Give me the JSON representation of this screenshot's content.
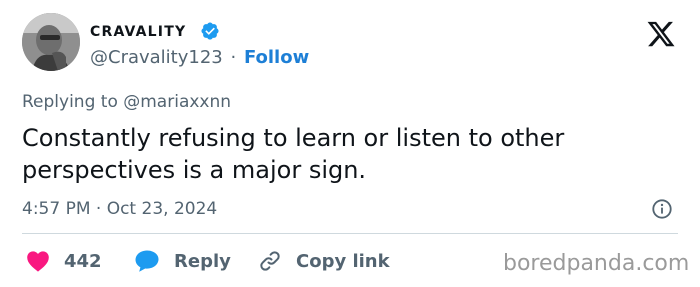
{
  "author": {
    "display_name": "CRAVALITY",
    "handle": "@Cravality123",
    "separator": "·",
    "follow_label": "Follow"
  },
  "reply_context": {
    "prefix": "Replying to",
    "mention": "@mariaxxnn"
  },
  "tweet": {
    "text": "Constantly refusing to learn or listen to other perspectives is a major sign.",
    "timestamp": "4:57 PM · Oct 23, 2024"
  },
  "actions": {
    "like_count": "442",
    "reply_label": "Reply",
    "copy_label": "Copy link"
  },
  "watermark": "boredpanda.com",
  "icons": [
    "verified-badge-icon",
    "x-logo-icon",
    "info-icon",
    "heart-icon",
    "reply-bubble-icon",
    "link-icon"
  ],
  "colors": {
    "accent": "#1d9bf0",
    "follow": "#1d7fd6",
    "heart": "#f91880",
    "secondary_text": "#536471",
    "primary_text": "#0f1419"
  }
}
